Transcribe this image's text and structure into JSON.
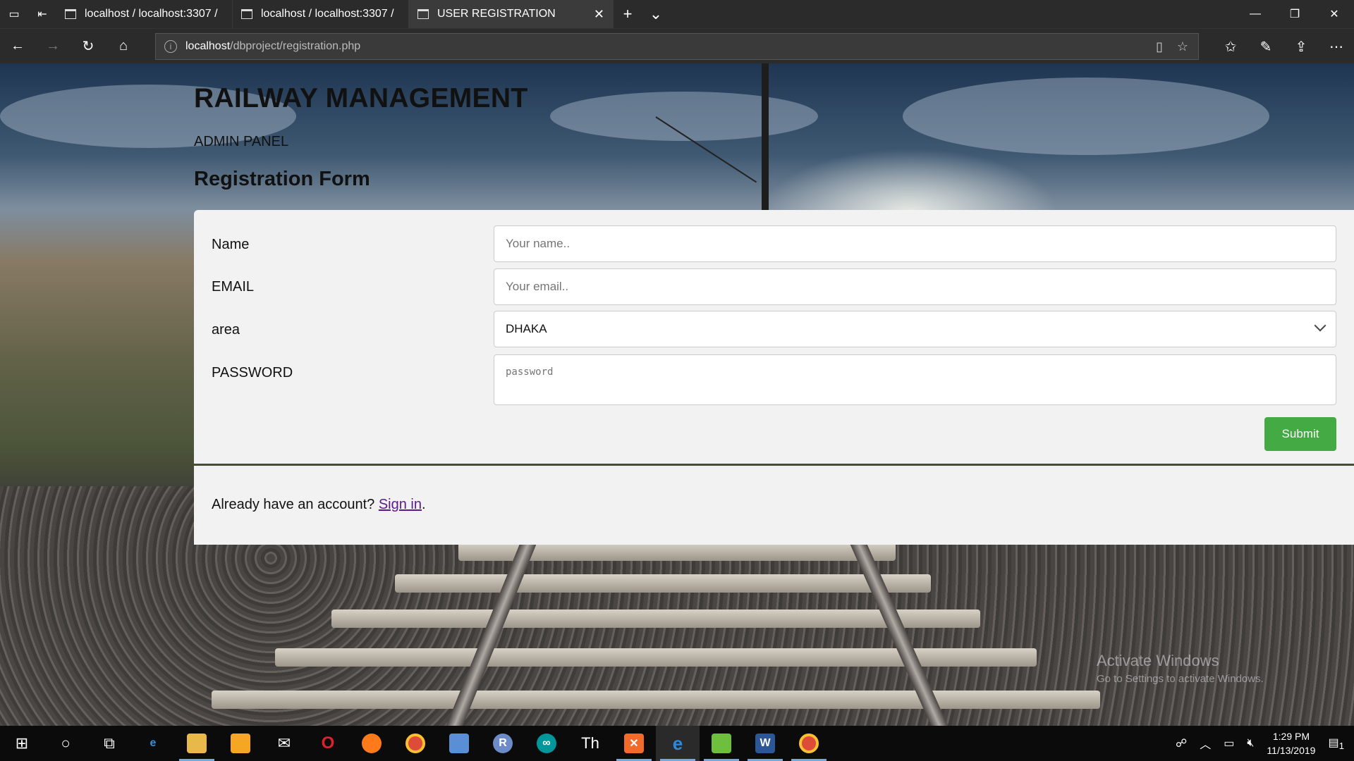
{
  "browser": {
    "tabs": [
      {
        "title": "localhost / localhost:3307 /",
        "active": false
      },
      {
        "title": "localhost / localhost:3307 /",
        "active": false
      },
      {
        "title": "USER REGISTRATION",
        "active": true
      }
    ],
    "address": {
      "host": "localhost",
      "path": "/dbproject/registration.php"
    }
  },
  "page": {
    "site_title": "RAILWAY MANAGEMENT",
    "panel_label": "ADMIN PANEL",
    "form_title": "Registration Form",
    "form": {
      "name_label": "Name",
      "name_placeholder": "Your name..",
      "email_label": "EMAIL",
      "email_placeholder": "Your email..",
      "area_label": "area",
      "area_selected": "DHAKA",
      "password_label": "PASSWORD",
      "password_placeholder": "password",
      "submit_label": "Submit"
    },
    "signin": {
      "prompt": "Already have an account?",
      "link_label": "Sign in",
      "suffix": "."
    }
  },
  "watermark": {
    "line1": "Activate Windows",
    "line2": "Go to Settings to activate Windows."
  },
  "taskbar": {
    "time": "1:29 PM",
    "date": "11/13/2019",
    "notification_count": "1",
    "text_app_label": "Th",
    "r_app_label": "R",
    "word_label": "W"
  },
  "colors": {
    "submit": "#44aa44",
    "link": "#5a1a8a",
    "card": "#f2f2f2"
  }
}
